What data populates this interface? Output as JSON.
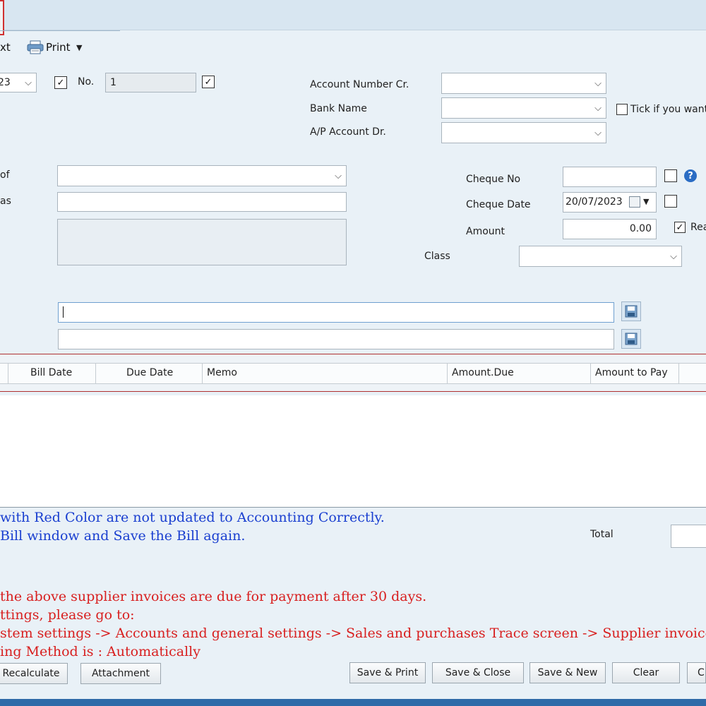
{
  "toolbar": {
    "next_label": "xt",
    "print_label": "Print"
  },
  "header": {
    "date_fragment": "23",
    "no_label": "No.",
    "no_value": "1"
  },
  "account": {
    "account_number_label": "Account Number Cr.",
    "bank_name_label": "Bank Name",
    "ap_account_label": "A/P Account Dr.",
    "tick_label": "Tick if you want"
  },
  "left_fields": {
    "label1_fragment": "of",
    "label2_fragment": "as"
  },
  "cheque": {
    "cheque_no_label": "Cheque No",
    "cheque_date_label": "Cheque Date",
    "cheque_date_value": "20/07/2023",
    "amount_label": "Amount",
    "amount_value": "0.00",
    "rea_fragment": "Rea",
    "class_label": "Class"
  },
  "grid": {
    "columns": [
      "Bill Date",
      "Due Date",
      "Memo",
      "Amount.Due",
      "Amount to Pay"
    ]
  },
  "messages": {
    "blue_line1": "with Red Color are not updated to Accounting Correctly.",
    "blue_line2": " Bill window and Save the Bill again.",
    "total_label": "Total",
    "red_line1": "the above supplier invoices are due for payment after 30 days.",
    "red_line2": "ttings, please go to:",
    "red_line3": "stem settings -> Accounts and general settings  -> Sales and purchases Trace screen -> Supplier invoice payment option.",
    "red_line4": "ing Method is : Automatically"
  },
  "buttons": {
    "recalculate": "Recalculate",
    "attachment": "Attachment",
    "save_print": "Save & Print",
    "save_close": "Save & Close",
    "save_new": "Save & New",
    "clear": "Clear",
    "close_fragment": "Cl"
  },
  "colors": {
    "accent_blue": "#1a3fd0",
    "warning_red": "#d81f1f",
    "grid_border_red": "#b03030"
  }
}
